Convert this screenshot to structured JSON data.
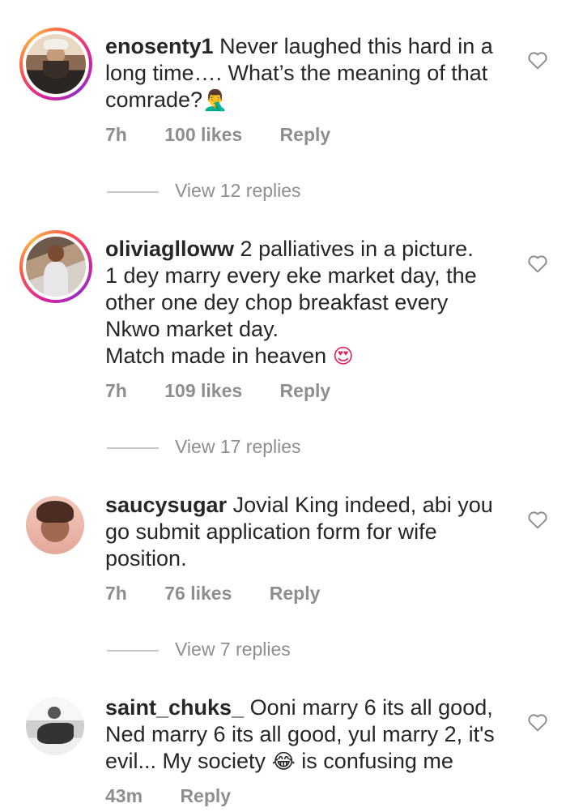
{
  "comments": [
    {
      "username": "enosenty1",
      "text_lines": [
        "Never laughed this hard in a",
        "long time…. What’s the meaning of that",
        "comrade?"
      ],
      "emoji": "🤦‍♂️",
      "time": "7h",
      "likes": "100 likes",
      "reply_label": "Reply",
      "view_replies": "View 12 replies",
      "has_story": true
    },
    {
      "username": "oliviaglloww",
      "text_lines": [
        "2 palliatives in a picture.",
        "1 dey marry every eke market day, the",
        "other one dey chop breakfast every",
        "Nkwo market day.",
        "Match made in heaven"
      ],
      "emoji": "😍",
      "time": "7h",
      "likes": "109 likes",
      "reply_label": "Reply",
      "view_replies": "View 17 replies",
      "has_story": true
    },
    {
      "username": "saucysugar",
      "text_lines": [
        "Jovial King indeed, abi you",
        "go submit application form for wife",
        "position."
      ],
      "time": "7h",
      "likes": "76 likes",
      "reply_label": "Reply",
      "view_replies": "View 7 replies",
      "has_story": false
    },
    {
      "username": "saint_chuks_",
      "text_lines": [
        "Ooni marry 6 its all good,",
        "Ned marry 6 its all good, yul marry 2, it's",
        "evil... My society",
        "is confusing me"
      ],
      "emoji": "😂",
      "time": "43m",
      "reply_label": "Reply",
      "has_story": false
    }
  ],
  "icons": {
    "like": "heart-outline-icon"
  },
  "colors": {
    "muted": "#8e8e8e",
    "text": "#262626"
  }
}
